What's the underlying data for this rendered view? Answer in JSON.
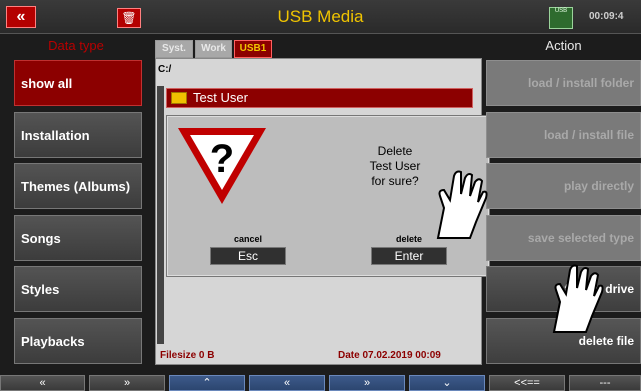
{
  "header": {
    "title": "USB Media",
    "back_icon": "«",
    "trash_icon": "🗑",
    "usb_badge": "USB",
    "time": "00:09:4"
  },
  "left": {
    "heading": "Data type",
    "items": [
      {
        "label": "show all"
      },
      {
        "label": "Installation"
      },
      {
        "label": "Themes (Albums)"
      },
      {
        "label": "Songs"
      },
      {
        "label": "Styles"
      },
      {
        "label": "Playbacks"
      }
    ]
  },
  "tabs": [
    {
      "label": "Syst."
    },
    {
      "label": "Work"
    },
    {
      "label": "USB1"
    }
  ],
  "browser": {
    "path": "C:/",
    "selected_row": "Test User",
    "filesize_label": "Filesize 0 B",
    "date_label": "Date 07.02.2019  00:09"
  },
  "dialog": {
    "line1": "Delete",
    "line2": "Test User",
    "line3": "for sure?",
    "cancel_label": "cancel",
    "cancel_key": "Esc",
    "delete_label": "delete",
    "delete_key": "Enter"
  },
  "right": {
    "heading": "Action",
    "items": [
      {
        "label": "load  /  install  folder"
      },
      {
        "label": "load  /  install  file"
      },
      {
        "label": "play  directly"
      },
      {
        "label": "save  selected  type"
      },
      {
        "label": "format  drive"
      },
      {
        "label": "delete  file"
      }
    ]
  },
  "bottom": {
    "buttons": [
      {
        "label": "«"
      },
      {
        "label": "»"
      },
      {
        "label": "⌃"
      },
      {
        "label": "«"
      },
      {
        "label": "»"
      },
      {
        "label": "⌄"
      },
      {
        "label": "<<=="
      },
      {
        "label": "---"
      }
    ]
  },
  "colors": {
    "accent_red": "#8c0000",
    "title_yellow": "#f0c400"
  }
}
